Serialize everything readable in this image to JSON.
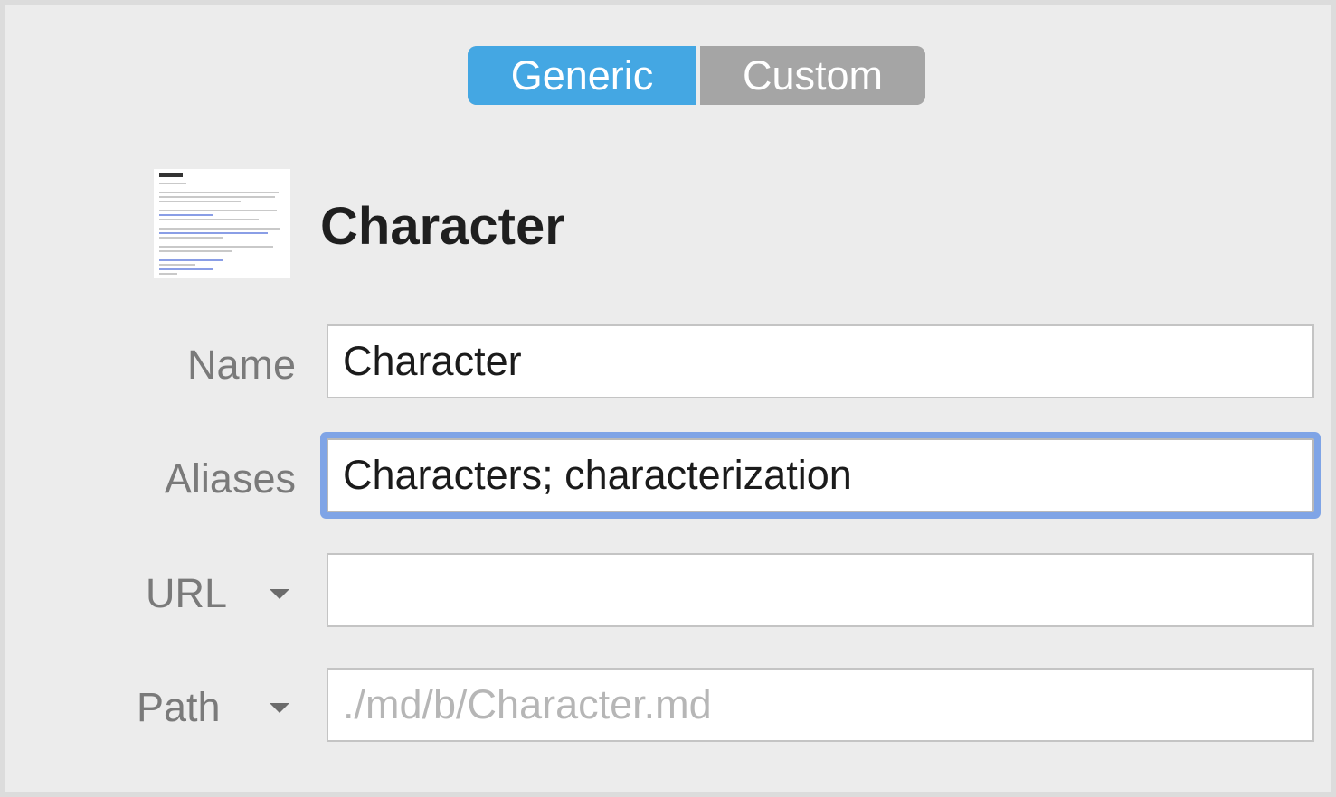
{
  "segments": {
    "generic_label": "Generic",
    "custom_label": "Custom",
    "selected": "Generic"
  },
  "header": {
    "title": "Character"
  },
  "form": {
    "name": {
      "label": "Name",
      "value": "Character"
    },
    "aliases": {
      "label": "Aliases",
      "value": "Characters; characterization"
    },
    "url": {
      "label": "URL",
      "value": ""
    },
    "path": {
      "label": "Path",
      "value": "",
      "placeholder": "./md/b/Character.md"
    }
  },
  "colors": {
    "accent": "#44a7e3",
    "focus_ring": "#7fa4e6",
    "segment_inactive": "#a5a5a5",
    "background": "#ececec"
  }
}
